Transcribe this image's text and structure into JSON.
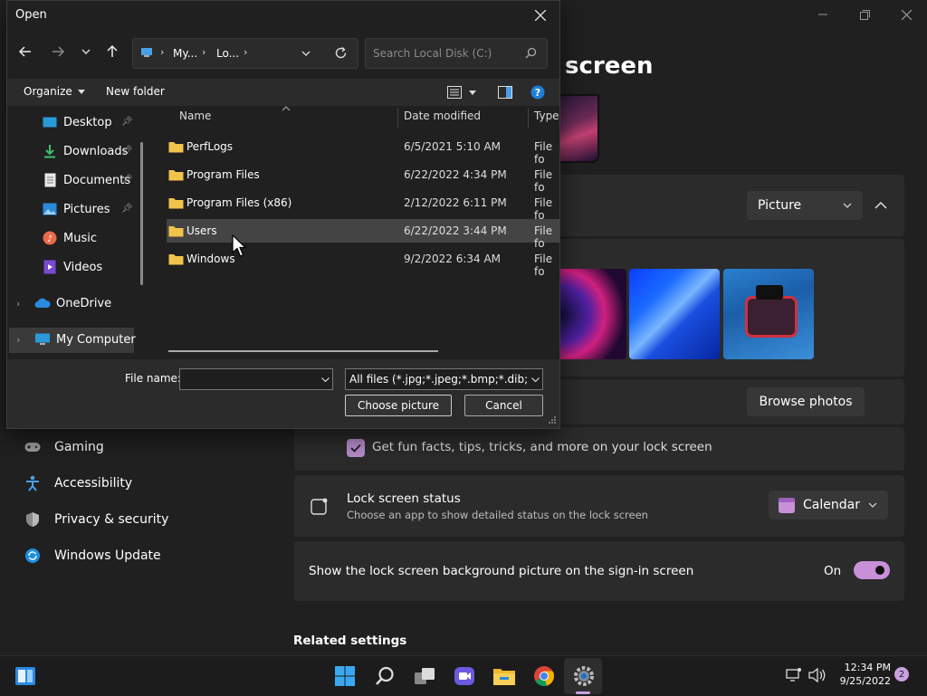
{
  "settings": {
    "page_title": "screen",
    "personalize_dropdown": "Picture",
    "browse_photos_label": "Browse photos",
    "fun_facts_label": "Get fun facts, tips, tricks, and more on your lock screen",
    "status_title": "Lock screen status",
    "status_subtitle": "Choose an app to show detailed status on the lock screen",
    "status_dropdown": "Calendar",
    "signin_label": "Show the lock screen background picture on the sign-in screen",
    "toggle_state": "On",
    "related_settings": "Related settings",
    "nav": [
      {
        "label": "Gaming",
        "icon": "gamepad-icon"
      },
      {
        "label": "Accessibility",
        "icon": "accessibility-icon"
      },
      {
        "label": "Privacy & security",
        "icon": "shield-icon"
      },
      {
        "label": "Windows Update",
        "icon": "update-icon"
      }
    ]
  },
  "dialog": {
    "title": "Open",
    "breadcrumb": [
      "My...",
      "Lo..."
    ],
    "search_placeholder": "Search Local Disk (C:)",
    "organize_label": "Organize",
    "new_folder_label": "New folder",
    "tree": [
      {
        "label": "Desktop",
        "icon": "desktop-icon",
        "pinned": true
      },
      {
        "label": "Downloads",
        "icon": "download-icon",
        "pinned": true
      },
      {
        "label": "Documents",
        "icon": "documents-icon",
        "pinned": true
      },
      {
        "label": "Pictures",
        "icon": "pictures-icon",
        "pinned": true
      },
      {
        "label": "Music",
        "icon": "music-icon",
        "pinned": false
      },
      {
        "label": "Videos",
        "icon": "videos-icon",
        "pinned": false
      },
      {
        "label": "OneDrive",
        "icon": "cloud-icon",
        "pinned": false
      },
      {
        "label": "My Computer",
        "icon": "computer-icon",
        "pinned": false
      }
    ],
    "columns": {
      "name": "Name",
      "date": "Date modified",
      "type": "Type"
    },
    "files": [
      {
        "name": "PerfLogs",
        "date": "6/5/2021 5:10 AM",
        "type": "File fo"
      },
      {
        "name": "Program Files",
        "date": "6/22/2022 4:34 PM",
        "type": "File fo"
      },
      {
        "name": "Program Files (x86)",
        "date": "2/12/2022 6:11 PM",
        "type": "File fo"
      },
      {
        "name": "Users",
        "date": "6/22/2022 3:44 PM",
        "type": "File fo"
      },
      {
        "name": "Windows",
        "date": "9/2/2022 6:34 AM",
        "type": "File fo"
      }
    ],
    "selected_file": "Users",
    "filename_label": "File name:",
    "filename_value": "",
    "filter_value": "All files (*.jpg;*.jpeg;*.bmp;*.dib;*.png",
    "choose_label": "Choose picture",
    "cancel_label": "Cancel"
  },
  "taskbar": {
    "time": "12:34 PM",
    "date": "9/25/2022",
    "notification_count": "2"
  }
}
